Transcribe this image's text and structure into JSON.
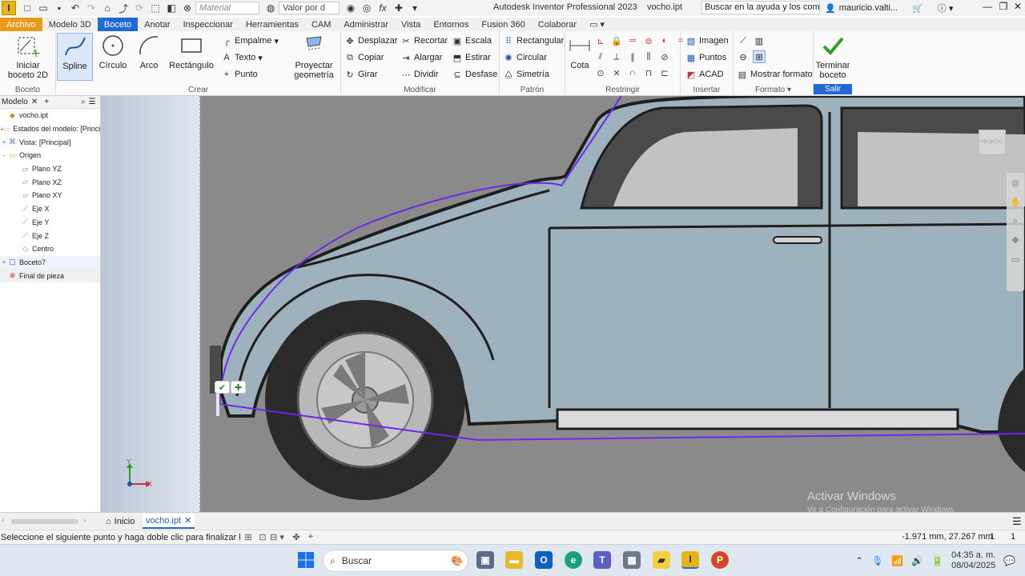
{
  "app": {
    "logo_letter": "I",
    "title": "Autodesk Inventor Professional 2023",
    "document": "vocho.ipt",
    "help_search_placeholder": "Buscar en la ayuda y los comandos...",
    "user": "mauricio.valti...",
    "material_combo": "Material",
    "valor_combo": "Valor por d"
  },
  "tabs": [
    "Archivo",
    "Modelo 3D",
    "Boceto",
    "Anotar",
    "Inspeccionar",
    "Herramientas",
    "CAM",
    "Administrar",
    "Vista",
    "Entornos",
    "Fusion 360",
    "Colaborar"
  ],
  "active_tab": "Boceto",
  "ribbon": {
    "boceto": {
      "label": "Boceto",
      "start_line1": "Iniciar",
      "start_line2": "boceto 2D"
    },
    "crear": {
      "label": "Crear",
      "spline": "Spline",
      "circulo": "Círculo",
      "arco": "Arco",
      "rectangulo": "Rectángulo",
      "empalme": "Empalme",
      "texto": "Texto",
      "punto": "Punto",
      "proyectar_line1": "Proyectar",
      "proyectar_line2": "geometría"
    },
    "modificar": {
      "label": "Modificar",
      "desplazar": "Desplazar",
      "copiar": "Copiar",
      "girar": "Girar",
      "recortar": "Recortar",
      "alargar": "Alargar",
      "dividir": "Dividir",
      "escala": "Escala",
      "estirar": "Estirar",
      "desfase": "Desfase"
    },
    "patron": {
      "label": "Patrón",
      "rectangular": "Rectangular",
      "circular": "Circular",
      "simetria": "Simetría"
    },
    "restringir": {
      "label": "Restringir",
      "cota": "Cota"
    },
    "insertar": {
      "label": "Insertar",
      "imagen": "Imagen",
      "puntos": "Puntos",
      "acad": "ACAD"
    },
    "formato": {
      "label": "Formato",
      "mostrar": "Mostrar formato"
    },
    "salir": {
      "label": "Salir",
      "terminar_line1": "Terminar",
      "terminar_line2": "boceto"
    }
  },
  "browser": {
    "tab": "Modelo",
    "items": [
      {
        "label": "vocho.ipt",
        "icon": "part-icon",
        "indent": 0,
        "twisty": ""
      },
      {
        "label": "Estados del modelo: [Principal]",
        "icon": "folder-icon",
        "indent": 0,
        "twisty": "+"
      },
      {
        "label": "Vista: [Principal]",
        "icon": "view-icon",
        "indent": 0,
        "twisty": "+"
      },
      {
        "label": "Origen",
        "icon": "folder-icon",
        "indent": 0,
        "twisty": "-"
      },
      {
        "label": "Plano YZ",
        "icon": "plane-icon",
        "indent": 1,
        "twisty": ""
      },
      {
        "label": "Plano XZ",
        "icon": "plane-icon",
        "indent": 1,
        "twisty": ""
      },
      {
        "label": "Plano XY",
        "icon": "plane-icon",
        "indent": 1,
        "twisty": ""
      },
      {
        "label": "Eje X",
        "icon": "axis-icon",
        "indent": 1,
        "twisty": ""
      },
      {
        "label": "Eje Y",
        "icon": "axis-icon",
        "indent": 1,
        "twisty": ""
      },
      {
        "label": "Eje Z",
        "icon": "axis-icon",
        "indent": 1,
        "twisty": ""
      },
      {
        "label": "Centro",
        "icon": "point-icon",
        "indent": 1,
        "twisty": ""
      },
      {
        "label": "Boceto7",
        "icon": "sketch-icon",
        "indent": 0,
        "twisty": "+"
      },
      {
        "label": "Final de pieza",
        "icon": "end-of-part-icon",
        "indent": 0,
        "twisty": ""
      }
    ]
  },
  "viewport": {
    "viewcube_label": "FRONTAL",
    "axis_x": "X",
    "axis_y": "Y",
    "activate_title": "Activar Windows",
    "activate_sub": "Ve a Configuración para activar Windows."
  },
  "doc_tabs": {
    "home": "Inicio",
    "doc": "vocho.ipt"
  },
  "status": {
    "message": "Seleccione el siguiente punto y haga doble clic para finalizar la sp...",
    "coords": "-1.971 mm, 27.267 mm",
    "n1": "1",
    "n2": "1"
  },
  "taskbar": {
    "search": "Buscar",
    "time": "04:35 a. m.",
    "date": "08/04/2025"
  },
  "colors": {
    "active_tab": "#1e6bd6",
    "file_tab": "#e89a1a",
    "spline": "#6a2be8",
    "car_body": "#9db2bd",
    "finish_check": "#2ca02c"
  }
}
